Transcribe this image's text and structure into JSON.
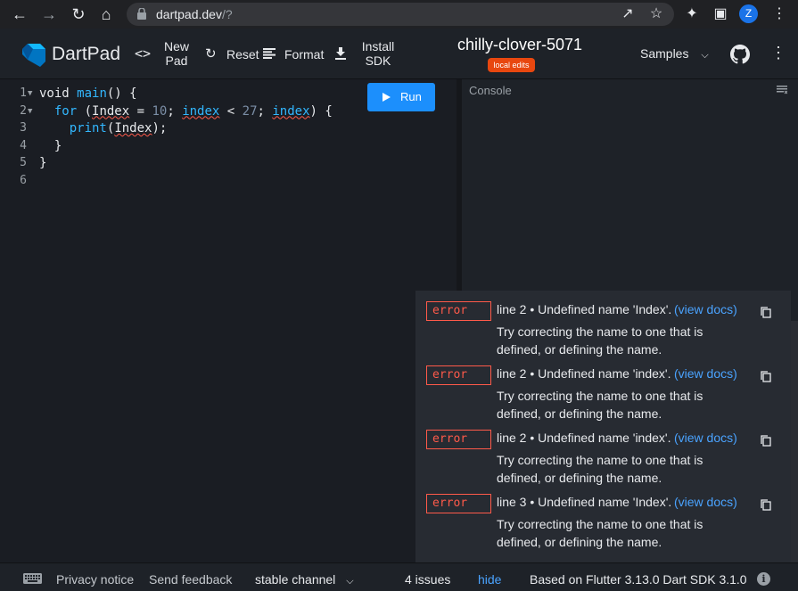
{
  "browser": {
    "url_host": "dartpad.dev",
    "url_path": "/?",
    "profile_initial": "Z"
  },
  "app": {
    "title": "DartPad",
    "new_pad_line1": "New",
    "new_pad_line2": "Pad",
    "reset": "Reset",
    "format": "Format",
    "install_line1": "Install",
    "install_line2": "SDK",
    "gist_title": "chilly-clover-5071",
    "local_edits": "local edits",
    "samples": "Samples"
  },
  "editor": {
    "run": "Run",
    "line_numbers": [
      "1",
      "2",
      "3",
      "4",
      "5",
      "6"
    ],
    "lines": [
      {
        "t1": "void ",
        "fn": "main",
        "t2": "() {"
      },
      {
        "kw": "for",
        "a": " (",
        "v1": "Index",
        "b": " = ",
        "n1": "10",
        "c": "; ",
        "v2": "index",
        "d": " < ",
        "n2": "27",
        "e": "; ",
        "v3": "index",
        "f": ") {"
      },
      {
        "fn": "print",
        "a": "(",
        "v1": "Index",
        "b": ");"
      },
      {
        "t1": "}"
      },
      {
        "t1": "}"
      },
      {
        "t1": ""
      }
    ]
  },
  "console": {
    "title": "Console"
  },
  "issues": [
    {
      "severity": "error",
      "message": "line 2 • Undefined name 'Index'.",
      "docs": "(view docs)",
      "hint": "Try correcting the name to one that is defined, or defining the name."
    },
    {
      "severity": "error",
      "message": "line 2 • Undefined name 'index'.",
      "docs": "(view docs)",
      "hint": "Try correcting the name to one that is defined, or defining the name."
    },
    {
      "severity": "error",
      "message": "line 2 • Undefined name 'index'.",
      "docs": "(view docs)",
      "hint": "Try correcting the name to one that is defined, or defining the name."
    },
    {
      "severity": "error",
      "message": "line 3 • Undefined name 'Index'.",
      "docs": "(view docs)",
      "hint": "Try correcting the name to one that is defined, or defining the name."
    }
  ],
  "status": {
    "privacy": "Privacy notice",
    "feedback": "Send feedback",
    "channel": "stable channel",
    "issue_count": "4 issues",
    "hide": "hide",
    "version": "Based on Flutter 3.13.0 Dart SDK 3.1.0"
  },
  "colors": {
    "accent": "#1c8ffc",
    "error": "#ff5a4a",
    "badge": "#e8470f"
  }
}
